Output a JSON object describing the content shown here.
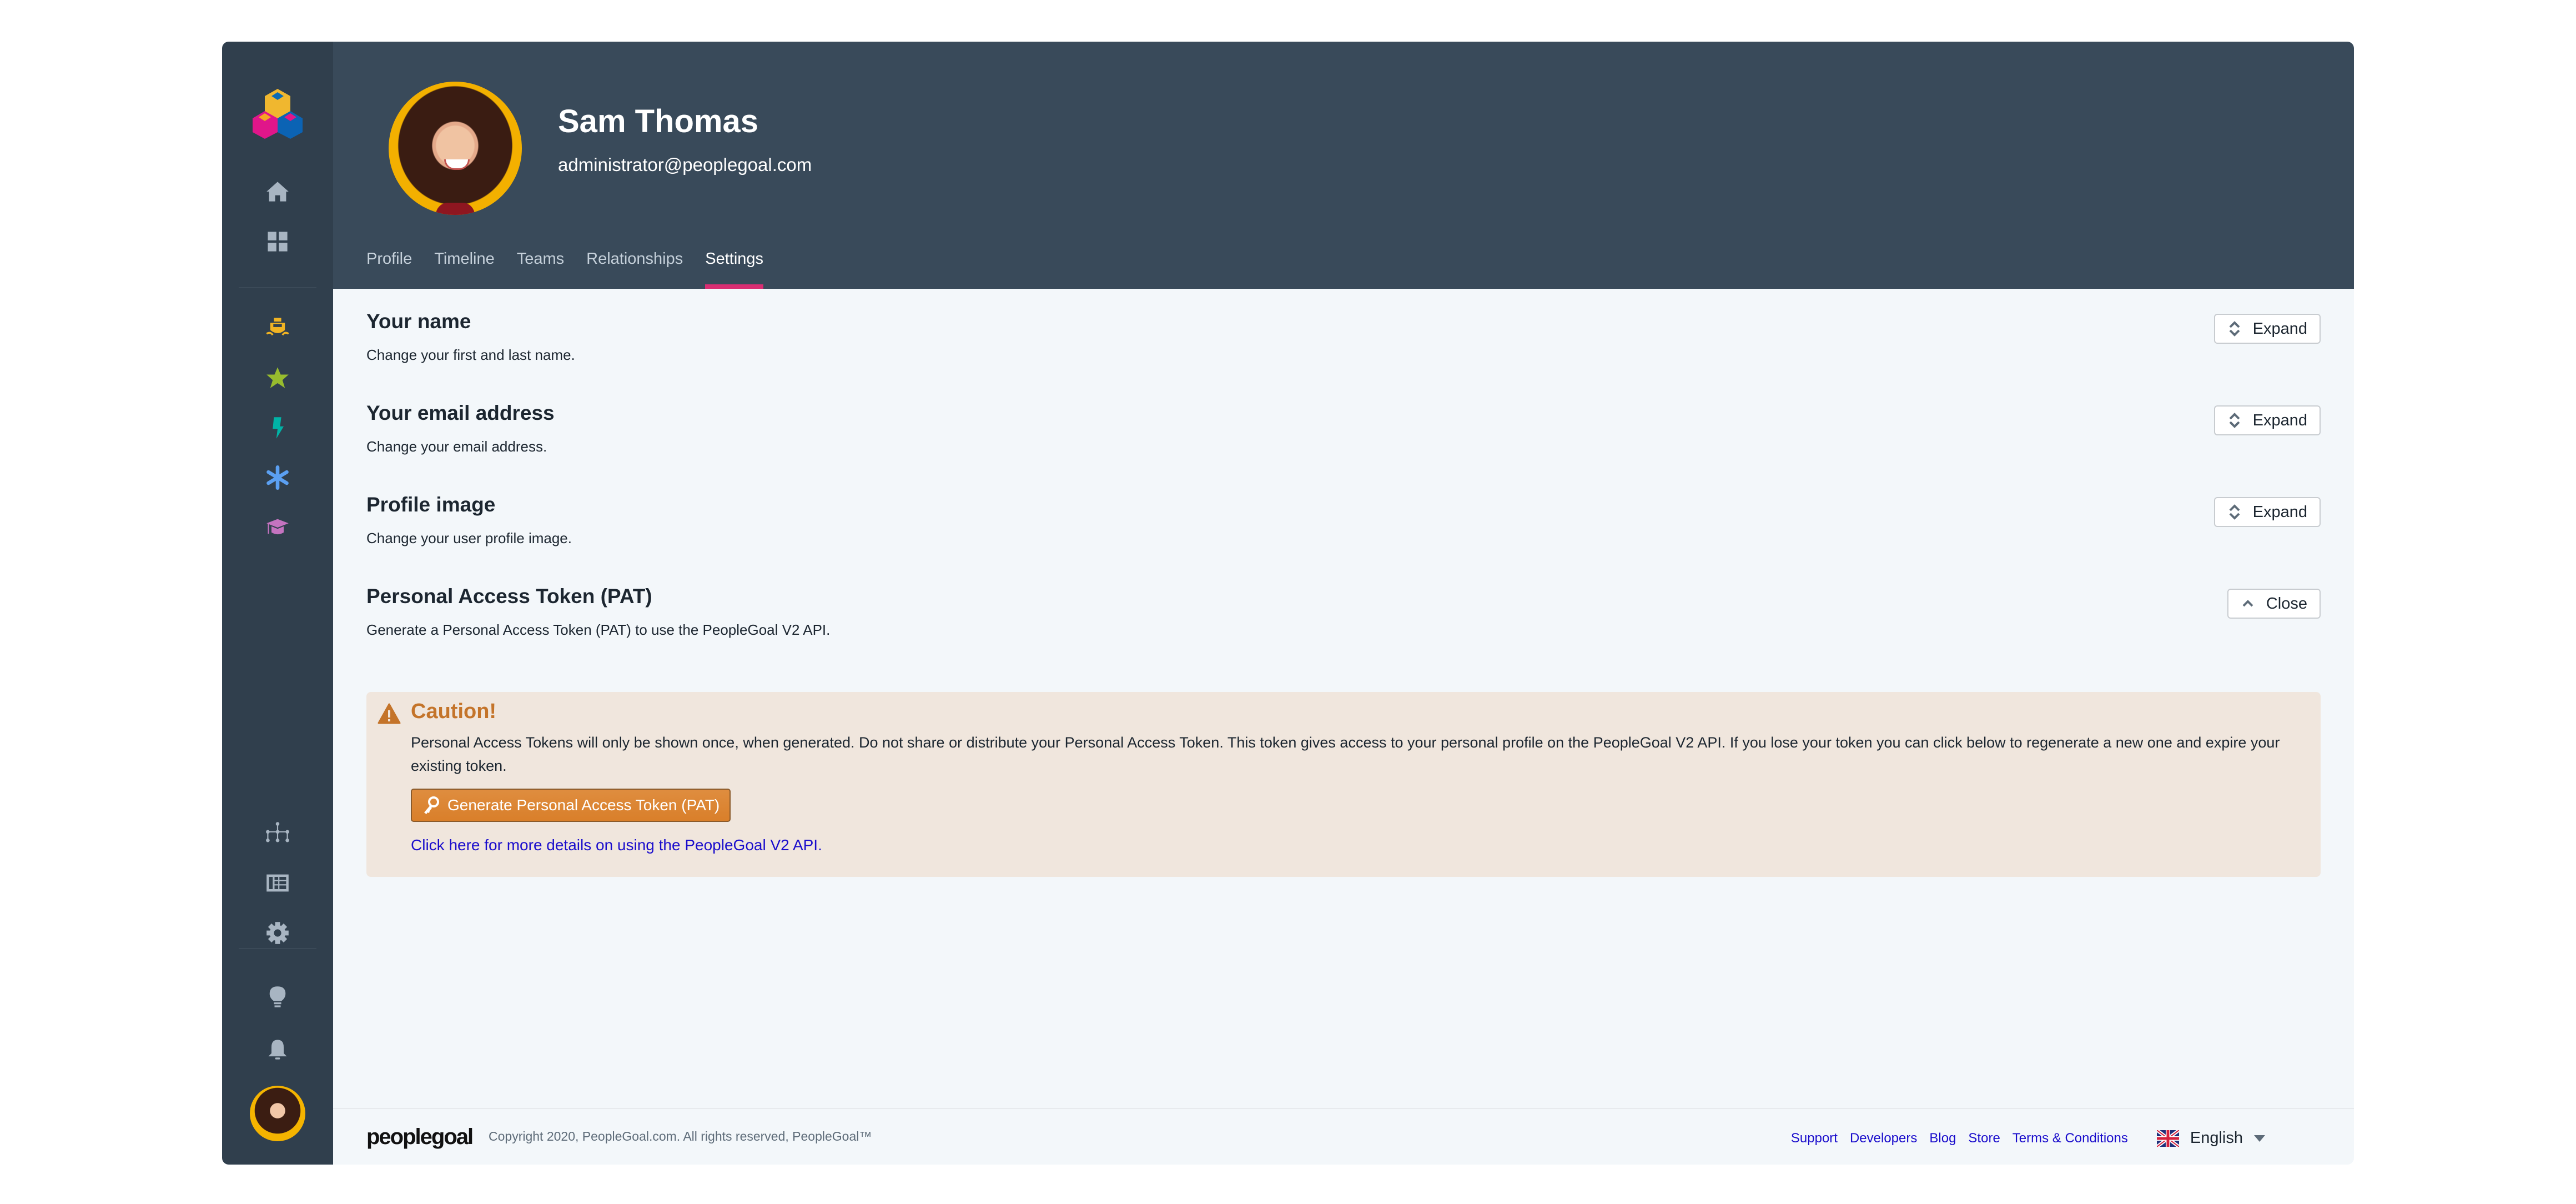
{
  "app": {
    "brand_colors": {
      "sidebar": "#303f4d",
      "header": "#394a5a",
      "accent": "#d92d72",
      "caution": "#c4742a",
      "link": "#1a0dcc"
    }
  },
  "sidebar": {
    "top_items": [
      {
        "icon": "home-icon",
        "color": "#a8b5c2"
      },
      {
        "icon": "dashboard-grid-icon",
        "color": "#a8b5c2"
      }
    ],
    "module_items": [
      {
        "icon": "ship-icon",
        "color": "#f0b323"
      },
      {
        "icon": "star-icon",
        "color": "#97bc2e"
      },
      {
        "icon": "lightning-icon",
        "color": "#00b3a6"
      },
      {
        "icon": "asterisk-icon",
        "color": "#5ba0f2"
      },
      {
        "icon": "graduation-cap-icon",
        "color": "#c473c0"
      }
    ],
    "admin_items": [
      {
        "icon": "org-chart-icon"
      },
      {
        "icon": "table-icon"
      },
      {
        "icon": "gear-icon"
      }
    ],
    "bottom_items": [
      {
        "icon": "lightbulb-icon"
      },
      {
        "icon": "bell-icon"
      }
    ]
  },
  "header": {
    "user_name": "Sam Thomas",
    "user_email": "administrator@peoplegoal.com",
    "tabs": [
      {
        "label": "Profile",
        "active": false
      },
      {
        "label": "Timeline",
        "active": false
      },
      {
        "label": "Teams",
        "active": false
      },
      {
        "label": "Relationships",
        "active": false
      },
      {
        "label": "Settings",
        "active": true
      }
    ]
  },
  "settings": {
    "sections": [
      {
        "title": "Your name",
        "description": "Change your first and last name.",
        "button": "Expand"
      },
      {
        "title": "Your email address",
        "description": "Change your email address.",
        "button": "Expand"
      },
      {
        "title": "Profile image",
        "description": "Change your user profile image.",
        "button": "Expand"
      },
      {
        "title": "Personal Access Token (PAT)",
        "description": "Generate a Personal Access Token (PAT) to use the PeopleGoal V2 API.",
        "button": "Close"
      }
    ],
    "caution": {
      "title": "Caution!",
      "body": "Personal Access Tokens will only be shown once, when generated. Do not share or distribute your Personal Access Token. This token gives access to your personal profile on the PeopleGoal V2 API. If you lose your token you can click below to regenerate a new one and expire your existing token.",
      "generate_button": "Generate Personal Access Token (PAT)",
      "api_link": "Click here for more details on using the PeopleGoal V2 API."
    }
  },
  "footer": {
    "logo": "peoplegoal",
    "copyright": "Copyright 2020, PeopleGoal.com. All rights reserved, PeopleGoal™",
    "links": [
      "Support",
      "Developers",
      "Blog",
      "Store",
      "Terms & Conditions"
    ],
    "language": "English"
  }
}
